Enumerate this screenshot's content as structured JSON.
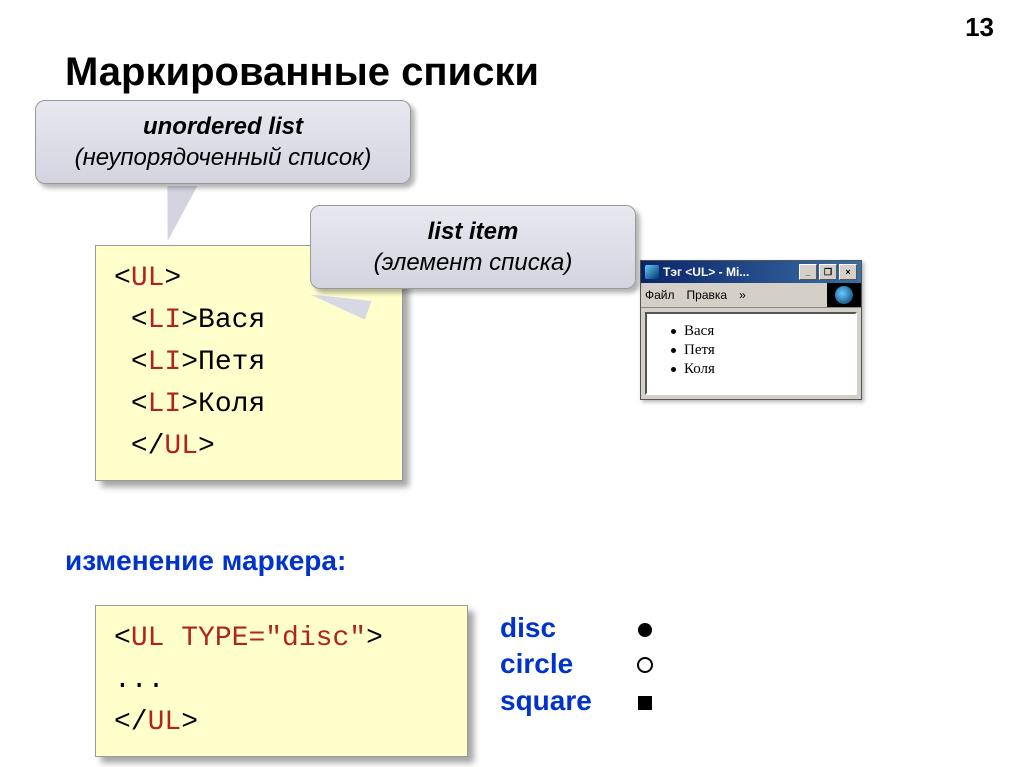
{
  "page_number": "13",
  "title": "Маркированные списки",
  "callouts": {
    "ul": {
      "term": "unordered list",
      "translation": "(неупорядоченный список)"
    },
    "li": {
      "term": "list item",
      "translation": "(элемент списка)"
    }
  },
  "code1": {
    "open_ul_l": "<",
    "open_ul_name": "UL",
    "open_ul_r": ">",
    "li1_l": "<",
    "li1_name": "LI",
    "li1_r": ">",
    "li1_text": "Вася",
    "li2_l": "<",
    "li2_name": "LI",
    "li2_r": ">",
    "li2_text": "Петя",
    "li3_l": "<",
    "li3_name": "LI",
    "li3_r": ">",
    "li3_text": "Коля",
    "close_ul_l": "</",
    "close_ul_name": "UL",
    "close_ul_r": ">"
  },
  "subheader": "изменение маркера:",
  "code2": {
    "open_l": "<",
    "open_name": "UL",
    "sp": " ",
    "attr": "TYPE=\"disc\"",
    "open_r": ">",
    "ellipsis": "...",
    "close_l": "</",
    "close_name": "UL",
    "close_r": ">"
  },
  "markers": {
    "disc": "disc",
    "circle": "circle",
    "square": "square"
  },
  "window": {
    "title": "Тэг <UL> - Mi...",
    "menu": {
      "file": "Файл",
      "edit": "Правка",
      "more": "»"
    },
    "buttons": {
      "min": "_",
      "max": "❐",
      "close": "×"
    },
    "items": [
      "Вася",
      "Петя",
      "Коля"
    ]
  }
}
